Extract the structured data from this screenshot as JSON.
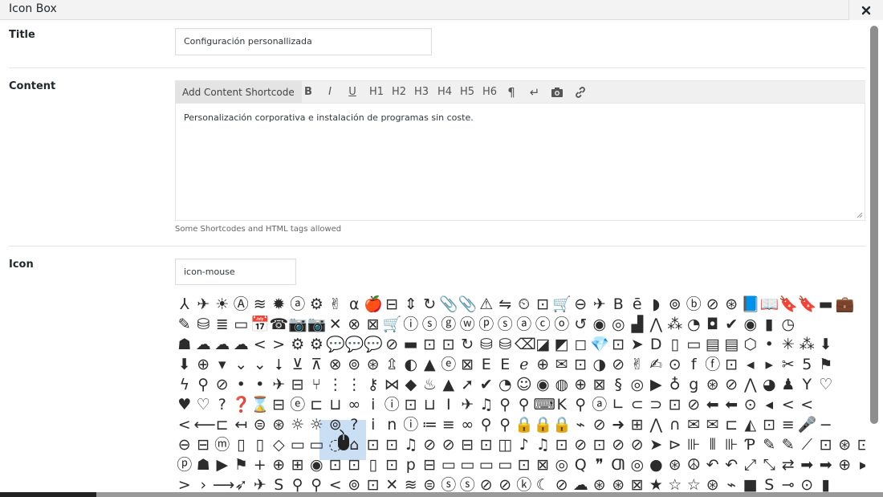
{
  "modal": {
    "title": "Icon Box",
    "close_icon": "close-icon"
  },
  "fields": {
    "title": {
      "label": "Title",
      "value": "Configuración personallizada"
    },
    "content": {
      "label": "Content",
      "toolbar": {
        "add_shortcode": "Add Content Shortcode",
        "buttons": [
          "B",
          "I",
          "U",
          "H1",
          "H2",
          "H3",
          "H4",
          "H5",
          "H6",
          "¶",
          "↵",
          "camera-icon",
          "link-icon"
        ]
      },
      "value": "Personalización corporativa e instalación de programas sin coste.",
      "hint": "Some Shortcodes and HTML tags allowed"
    },
    "icon": {
      "label": "Icon",
      "value": "icon-mouse",
      "selected": "mouse-icon"
    }
  },
  "icon_grid": {
    "rows": [
      "⅄✈☀Ⓐ≋✹ⓐ⚙✌α🍎⊟⇕↻📎📎⚠⇋⏲⊡🛒⊖✈Bē◗⊚ⓑ⊘⊛📘📖🔖🔖▬💼",
      "✎⛁≣▭📅☎📷📷✕⊗⊠🛒ⓘⓢⓖⓦⓟⓢⓐⓒⓞ↺◉◎▟⋀⁂◔◘✔◉▮◷",
      "☗☁☁☁<>⚙⚙💬💬💬⊘▬⊡⊡↻⛁⛁⌫◪◩◻💎⊡➤D▯▭▤▤⬡•✳⁂⬇",
      "⬇⊕▾⌄⌄⭣⊻⊼⊗⊚⊛⇫◐▲ⓔ⊠EEℯ⊕✉⊡◑⊘✌✍⊙fⓕ⊡◂▸✂5⚑",
      "ϟ⚲⊘••✈⊟⑂⋮⋮⚷⋈◆♨▲➚✔◔☺◉◍⊕⊠§◎▶♁g⊛⊘⋀◕♟Y♡",
      "♥♡?❓⌛⊟ⓔ⊏⊔∞iⓘ⊡⊔I✈♫⚲⚲⌨K⚲ⓐ∟⊂⊃⊡⊘⬅⬅⊙◂<<",
      "<⟵⊏↤⊜⊛☼☼⊚?inⓘ≔≡∞⚲⚲🔒🔒🔒⌁⊘➜⊞⋀∩✉✉⊏◭⊡≡🎤−",
      "⊖⊟ⓜ▯▯◇▭▭◌⌂⊡⊡♫⊘⊘⊟⊡◫♪♫⊡⊘⊡⊘⊘➤⊳⊪⫴⊪Ƥ✎✎⟋⊡⊛⊡✈Ⓟ",
      "ⓟ☗▶⚑+⊕⊞◉⊡⊡▯⊡p⊟▭▭▭▭⊡⊠◎Q❞Ƣ◎●⊛☮↶↶⤢⤡⇄➡➡⊕▸>",
      ">›⟶➶✈S⚲⚲<⊚⊡✕≋⊜ⓢⓢ⊘⊘ⓚ☾⊘☁⊛⊛⊠★☆☆⊛⌁■S⊸⊙▮"
    ]
  }
}
